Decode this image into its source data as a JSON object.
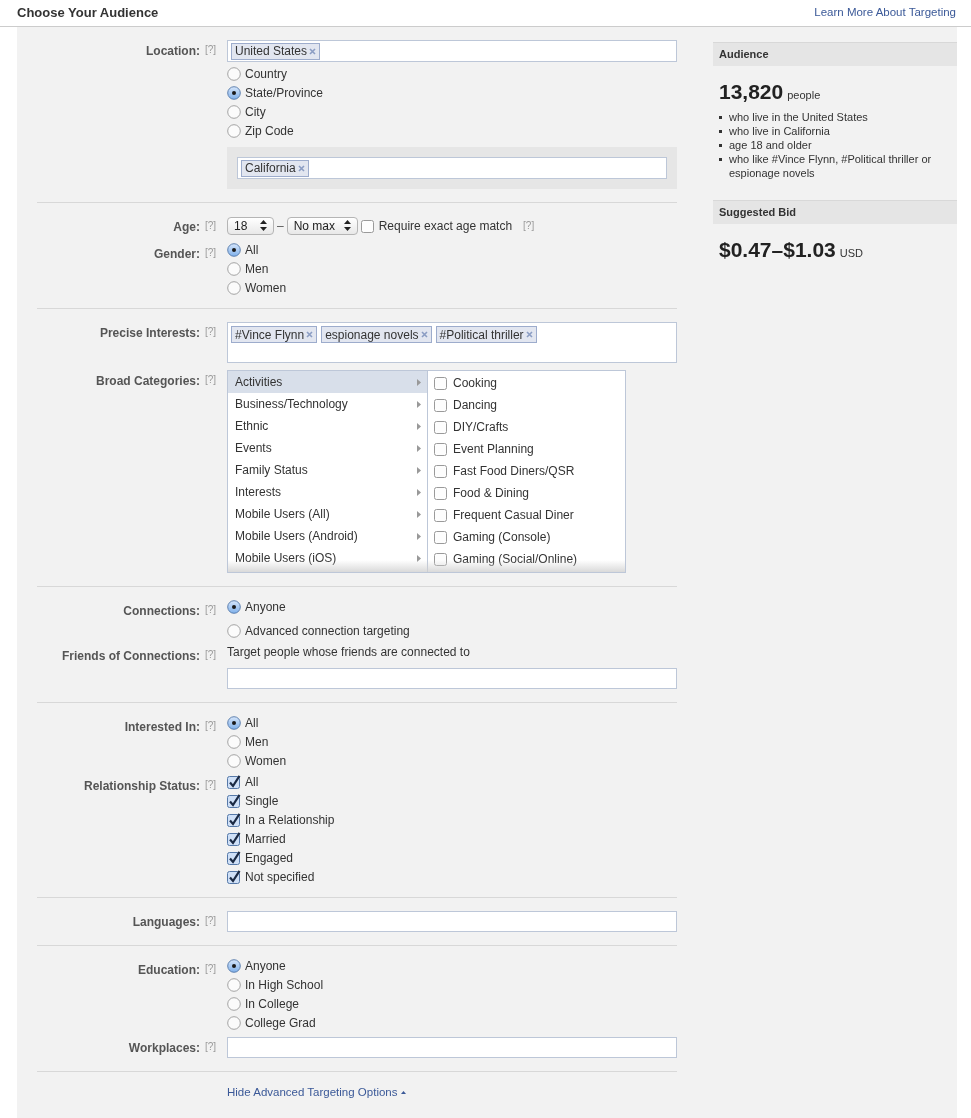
{
  "header": {
    "title": "Choose Your Audience",
    "link": "Learn More About Targeting"
  },
  "sections": [
    {
      "rows": [
        {
          "label": "Location:",
          "help": "[?]",
          "content": [
            {
              "kind": "token_field",
              "tokens": [
                "United States"
              ]
            },
            {
              "kind": "radio_group",
              "options": [
                {
                  "label": "Country",
                  "selected": false
                },
                {
                  "label": "State/Province",
                  "selected": true
                },
                {
                  "label": "City",
                  "selected": false
                },
                {
                  "label": "Zip Code",
                  "selected": false
                }
              ]
            },
            {
              "kind": "subpanel",
              "tokens": [
                "California"
              ]
            }
          ]
        }
      ]
    },
    {
      "rows": [
        {
          "label": "Age:",
          "help": "[?]",
          "content": [
            {
              "kind": "age",
              "min": "18",
              "dash": "–",
              "max": "No max",
              "exact": {
                "label": "Require exact age match",
                "checked": false
              },
              "help": "[?]"
            }
          ]
        },
        {
          "label": "Gender:",
          "help": "[?]",
          "content": [
            {
              "kind": "radio_group",
              "options": [
                {
                  "label": "All",
                  "selected": true
                },
                {
                  "label": "Men",
                  "selected": false
                },
                {
                  "label": "Women",
                  "selected": false
                }
              ]
            }
          ]
        }
      ]
    },
    {
      "rows": [
        {
          "label": "Precise Interests:",
          "help": "[?]",
          "content": [
            {
              "kind": "tall_token_field",
              "tokens": [
                "#Vince Flynn",
                "espionage novels",
                "#Political thriller"
              ]
            }
          ]
        },
        {
          "label": "Broad Categories:",
          "help": "[?]",
          "content": [
            {
              "kind": "categories",
              "groups": [
                {
                  "label": "Activities",
                  "selected": true
                },
                {
                  "label": "Business/Technology",
                  "selected": false
                },
                {
                  "label": "Ethnic",
                  "selected": false
                },
                {
                  "label": "Events",
                  "selected": false
                },
                {
                  "label": "Family Status",
                  "selected": false
                },
                {
                  "label": "Interests",
                  "selected": false
                },
                {
                  "label": "Mobile Users (All)",
                  "selected": false
                },
                {
                  "label": "Mobile Users (Android)",
                  "selected": false
                },
                {
                  "label": "Mobile Users (iOS)",
                  "selected": false
                }
              ],
              "items": [
                {
                  "label": "Cooking",
                  "checked": false
                },
                {
                  "label": "Dancing",
                  "checked": false
                },
                {
                  "label": "DIY/Crafts",
                  "checked": false
                },
                {
                  "label": "Event Planning",
                  "checked": false
                },
                {
                  "label": "Fast Food Diners/QSR",
                  "checked": false
                },
                {
                  "label": "Food & Dining",
                  "checked": false
                },
                {
                  "label": "Frequent Casual Diner",
                  "checked": false
                },
                {
                  "label": "Gaming (Console)",
                  "checked": false
                },
                {
                  "label": "Gaming (Social/Online)",
                  "checked": false
                }
              ]
            }
          ]
        }
      ]
    },
    {
      "rows": [
        {
          "label": "Connections:",
          "help": "[?]",
          "content": [
            {
              "kind": "radio_group",
              "spaced": true,
              "options": [
                {
                  "label": "Anyone",
                  "selected": true
                },
                {
                  "label": "Advanced connection targeting",
                  "selected": false
                }
              ]
            }
          ]
        },
        {
          "label": "Friends of Connections:",
          "help": "[?]",
          "content": [
            {
              "kind": "note",
              "text": "Target people whose friends are connected to"
            },
            {
              "kind": "text_field"
            }
          ]
        }
      ]
    },
    {
      "rows": [
        {
          "label": "Interested In:",
          "help": "[?]",
          "content": [
            {
              "kind": "radio_group",
              "options": [
                {
                  "label": "All",
                  "selected": true
                },
                {
                  "label": "Men",
                  "selected": false
                },
                {
                  "label": "Women",
                  "selected": false
                }
              ]
            }
          ]
        },
        {
          "label": "Relationship Status:",
          "help": "[?]",
          "content": [
            {
              "kind": "checkbox_group",
              "options": [
                {
                  "label": "All",
                  "checked": true
                },
                {
                  "label": "Single",
                  "checked": true
                },
                {
                  "label": "In a Relationship",
                  "checked": true
                },
                {
                  "label": "Married",
                  "checked": true
                },
                {
                  "label": "Engaged",
                  "checked": true
                },
                {
                  "label": "Not specified",
                  "checked": true
                }
              ]
            }
          ]
        }
      ]
    },
    {
      "rows": [
        {
          "label": "Languages:",
          "help": "[?]",
          "content": [
            {
              "kind": "text_field"
            }
          ]
        }
      ]
    },
    {
      "rows": [
        {
          "label": "Education:",
          "help": "[?]",
          "content": [
            {
              "kind": "radio_group",
              "options": [
                {
                  "label": "Anyone",
                  "selected": true
                },
                {
                  "label": "In High School",
                  "selected": false
                },
                {
                  "label": "In College",
                  "selected": false
                },
                {
                  "label": "College Grad",
                  "selected": false
                }
              ]
            }
          ]
        },
        {
          "label": "Workplaces:",
          "help": "[?]",
          "content": [
            {
              "kind": "text_field"
            }
          ]
        }
      ]
    }
  ],
  "footer_link": "Hide Advanced Targeting Options",
  "audience": {
    "title": "Audience",
    "count": "13,820",
    "unit": "people",
    "criteria": [
      "who live in the United States",
      "who live in California",
      "age 18 and older",
      "who like #Vince Flynn, #Political thriller or espionage novels"
    ]
  },
  "bid": {
    "title": "Suggested Bid",
    "range": "$0.47–$1.03",
    "currency": "USD"
  }
}
